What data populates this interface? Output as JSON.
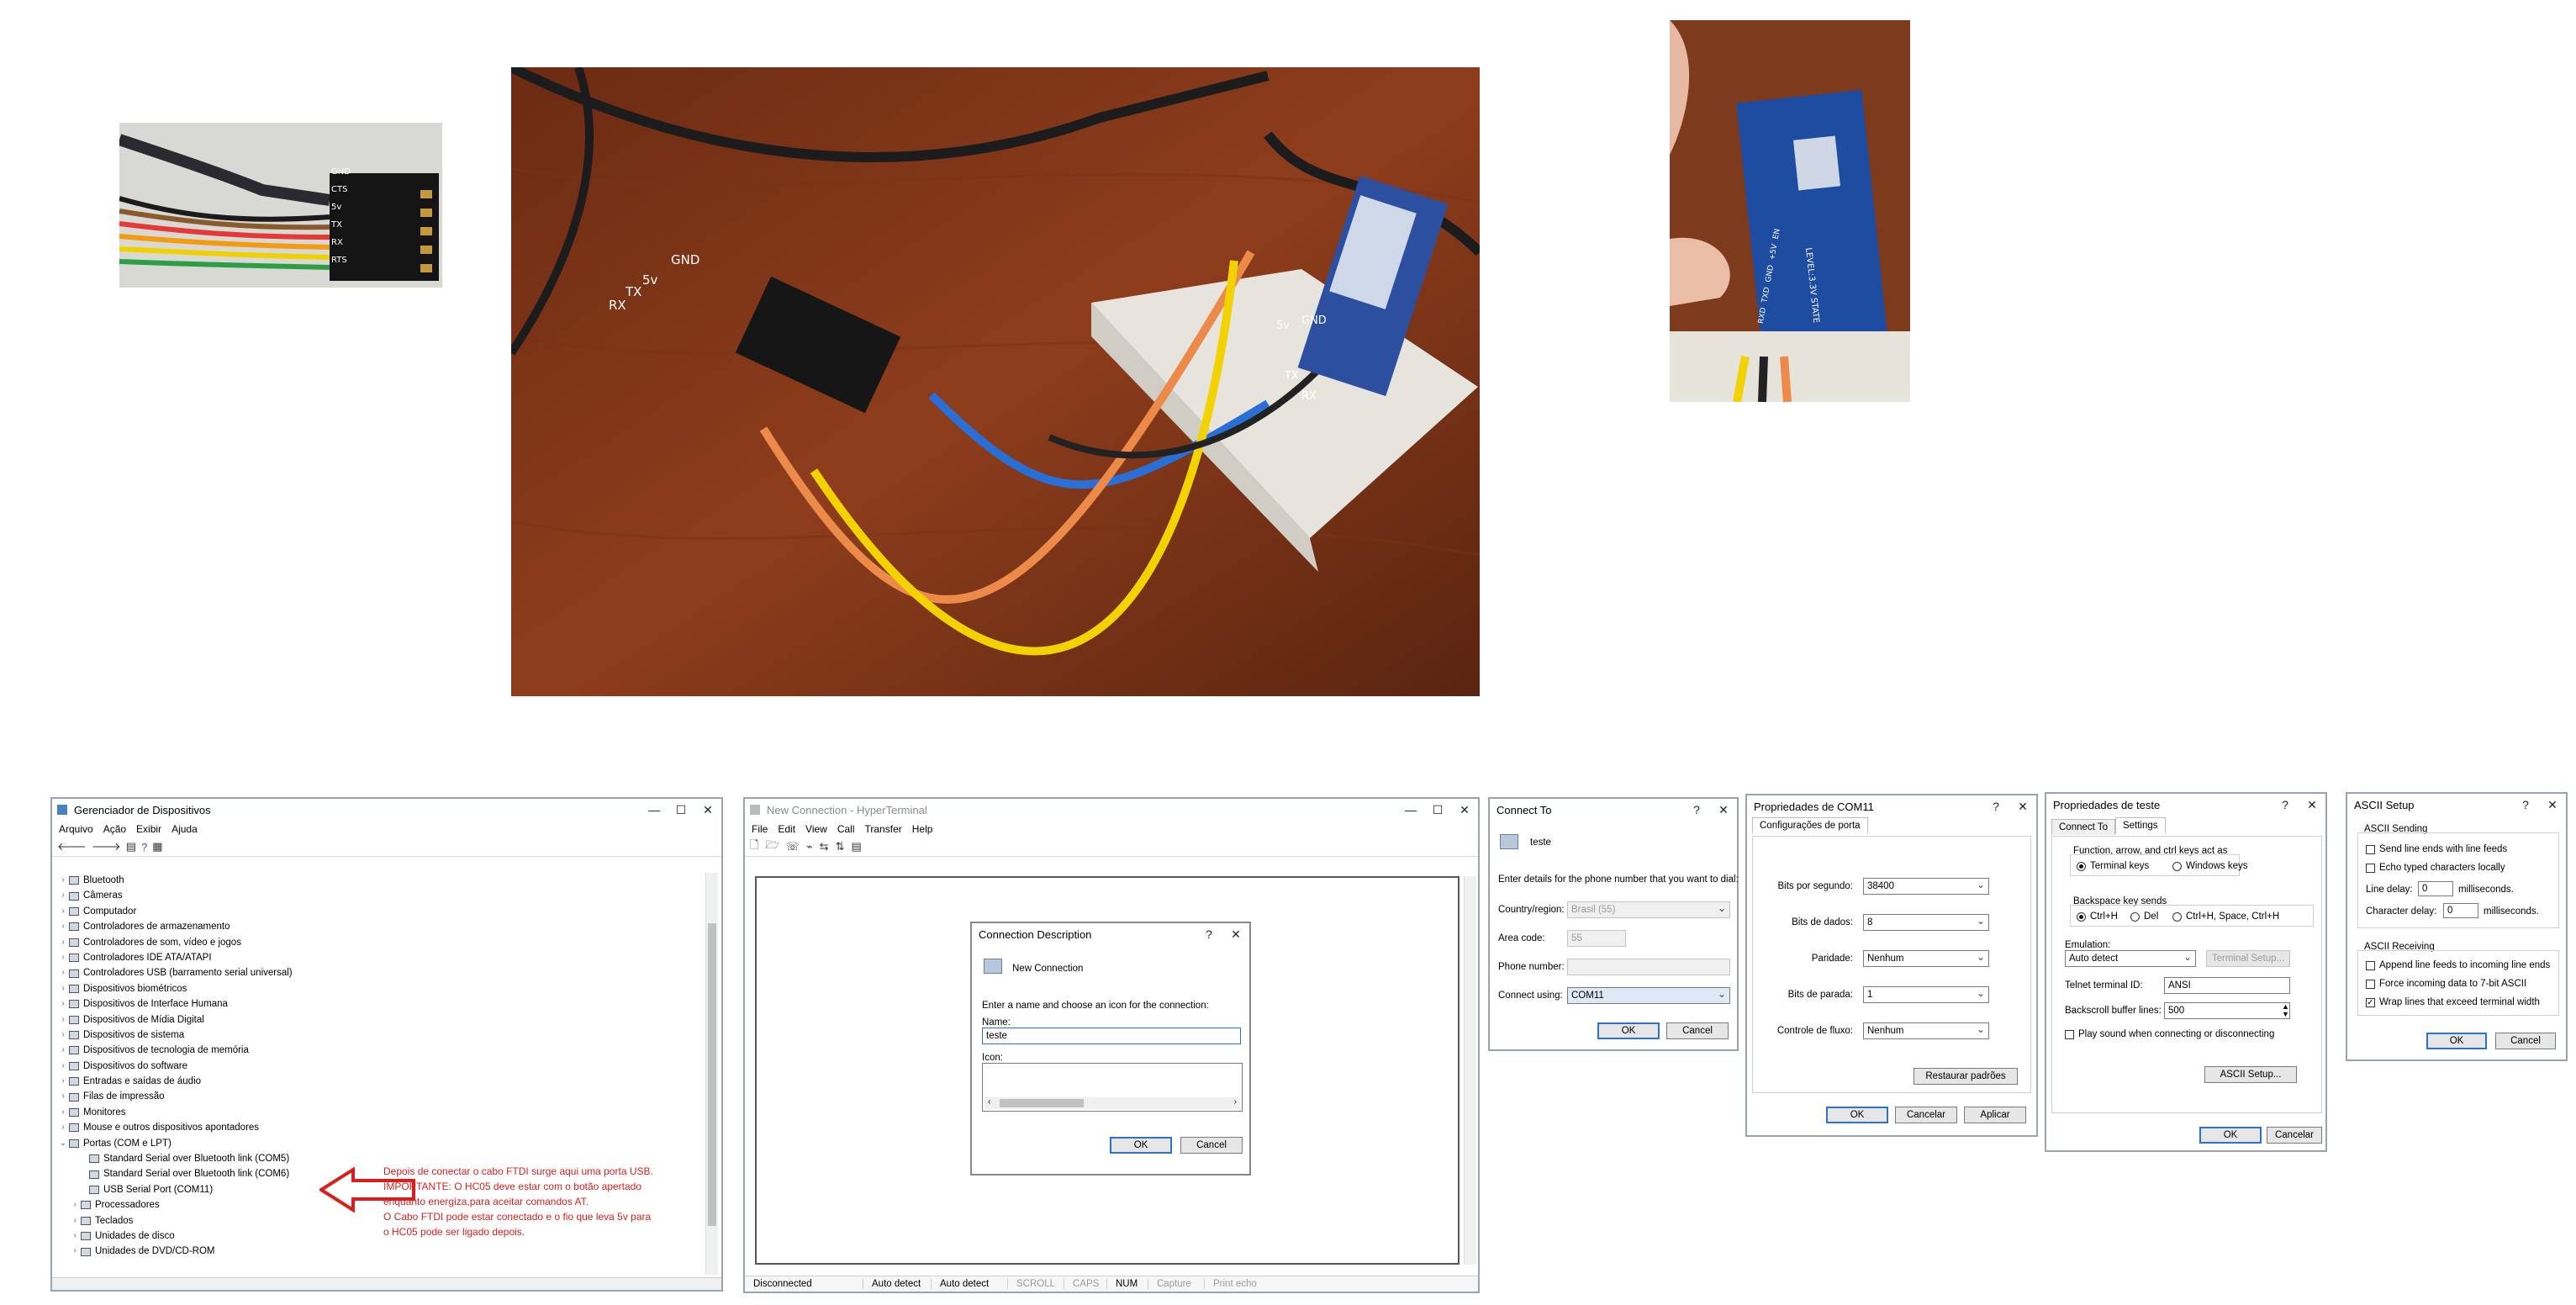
{
  "photos": {
    "cable_labels": [
      "GND",
      "CTS",
      "5v",
      "TX",
      "RX",
      "RTS"
    ],
    "breadboard_labels": {
      "ftdi": [
        "GND",
        "5v",
        "TX",
        "RX"
      ],
      "hc05": [
        "5v",
        "GND",
        "TX",
        "RX"
      ]
    },
    "module_labels": [
      "LEVEL:3.3V",
      "STATE",
      "RXD",
      "TXD",
      "GND",
      "+5V",
      "EN"
    ]
  },
  "device_manager": {
    "title": "Gerenciador de Dispositivos",
    "menu": [
      "Arquivo",
      "Ação",
      "Exibir",
      "Ajuda"
    ],
    "tree": [
      {
        "label": "Bluetooth",
        "expanded": false
      },
      {
        "label": "Câmeras",
        "expanded": false
      },
      {
        "label": "Computador",
        "expanded": false
      },
      {
        "label": "Controladores de armazenamento",
        "expanded": false
      },
      {
        "label": "Controladores de som, vídeo e jogos",
        "expanded": false
      },
      {
        "label": "Controladores IDE ATA/ATAPI",
        "expanded": false
      },
      {
        "label": "Controladores USB (barramento serial universal)",
        "expanded": false
      },
      {
        "label": "Dispositivos biométricos",
        "expanded": false
      },
      {
        "label": "Dispositivos de Interface Humana",
        "expanded": false
      },
      {
        "label": "Dispositivos de Mídia Digital",
        "expanded": false
      },
      {
        "label": "Dispositivos de sistema",
        "expanded": false
      },
      {
        "label": "Dispositivos de tecnologia de memória",
        "expanded": false
      },
      {
        "label": "Dispositivos do software",
        "expanded": false
      },
      {
        "label": "Entradas e saídas de áudio",
        "expanded": false
      },
      {
        "label": "Filas de impressão",
        "expanded": false
      },
      {
        "label": "Monitores",
        "expanded": false
      },
      {
        "label": "Mouse e outros dispositivos apontadores",
        "expanded": false
      },
      {
        "label": "Portas (COM e LPT)",
        "expanded": true
      }
    ],
    "ports": [
      "Standard Serial over Bluetooth link (COM5)",
      "Standard Serial over Bluetooth link (COM6)",
      "USB Serial Port (COM11)"
    ],
    "tree_after": [
      "Processadores",
      "Teclados",
      "Unidades de disco",
      "Unidades de DVD/CD-ROM"
    ],
    "annotation": [
      "Depois de conectar o cabo FTDI surge aqui uma porta USB.",
      "IMPORTANTE: O HC05 deve estar  com o botão apertado",
      "enquanto energiza,para aceitar comandos AT.",
      "O Cabo FTDI pode estar conectado e o fio que leva 5v para",
      "o HC05 pode ser ligado depois."
    ],
    "annotation_color": "#d91e1e"
  },
  "hyperterminal": {
    "title": "New Connection - HyperTerminal",
    "menu": [
      "File",
      "Edit",
      "View",
      "Call",
      "Transfer",
      "Help"
    ],
    "status": [
      "Disconnected",
      "Auto detect",
      "Auto detect",
      "SCROLL",
      "CAPS",
      "NUM",
      "Capture",
      "Print echo"
    ],
    "dialog": {
      "title": "Connection Description",
      "heading": "New Connection",
      "instruction": "Enter a name and choose an icon for the connection:",
      "name_label": "Name:",
      "name_value": "teste",
      "icon_label": "Icon:",
      "ok": "OK",
      "cancel": "Cancel"
    }
  },
  "connect_to": {
    "title": "Connect To",
    "name": "teste",
    "instruction": "Enter details for the phone number that you want to dial:",
    "country_label": "Country/region:",
    "country_value": "Brasil (55)",
    "area_label": "Area code:",
    "area_value": "55",
    "phone_label": "Phone number:",
    "phone_value": "",
    "using_label": "Connect using:",
    "using_value": "COM11",
    "ok": "OK",
    "cancel": "Cancel"
  },
  "com_props": {
    "title": "Propriedades de COM11",
    "tab": "Configurações de porta",
    "fields": [
      {
        "label": "Bits por segundo:",
        "value": "38400"
      },
      {
        "label": "Bits de dados:",
        "value": "8"
      },
      {
        "label": "Paridade:",
        "value": "Nenhum"
      },
      {
        "label": "Bits de parada:",
        "value": "1"
      },
      {
        "label": "Controle de fluxo:",
        "value": "Nenhum"
      }
    ],
    "restore": "Restaurar padrões",
    "ok": "OK",
    "cancel": "Cancelar",
    "apply": "Aplicar"
  },
  "teste_props": {
    "title": "Propriedades de teste",
    "tabs": [
      "Connect To",
      "Settings"
    ],
    "keys_label": "Function, arrow, and ctrl keys act as",
    "keys_opts": [
      "Terminal keys",
      "Windows keys"
    ],
    "backspace_label": "Backspace key sends",
    "backspace_opts": [
      "Ctrl+H",
      "Del",
      "Ctrl+H, Space, Ctrl+H"
    ],
    "emulation_label": "Emulation:",
    "emulation_value": "Auto detect",
    "terminal_setup": "Terminal Setup...",
    "telnet_label": "Telnet terminal ID:",
    "telnet_value": "ANSI",
    "buffer_label": "Backscroll buffer lines:",
    "buffer_value": "500",
    "sound_label": "Play sound when connecting or disconnecting",
    "ascii_setup": "ASCII Setup...",
    "ok": "OK",
    "cancel": "Cancelar"
  },
  "ascii_setup": {
    "title": "ASCII Setup",
    "sending_label": "ASCII Sending",
    "send_line_ends": "Send line ends with line feeds",
    "echo": "Echo typed characters locally",
    "line_delay_label": "Line delay:",
    "line_delay_value": "0",
    "char_delay_label": "Character delay:",
    "char_delay_value": "0",
    "ms": "milliseconds.",
    "receiving_label": "ASCII Receiving",
    "append_lf": "Append line feeds to incoming line ends",
    "force_7bit": "Force incoming data to 7-bit ASCII",
    "wrap": "Wrap lines that exceed terminal width",
    "ok": "OK",
    "cancel": "Cancel"
  }
}
